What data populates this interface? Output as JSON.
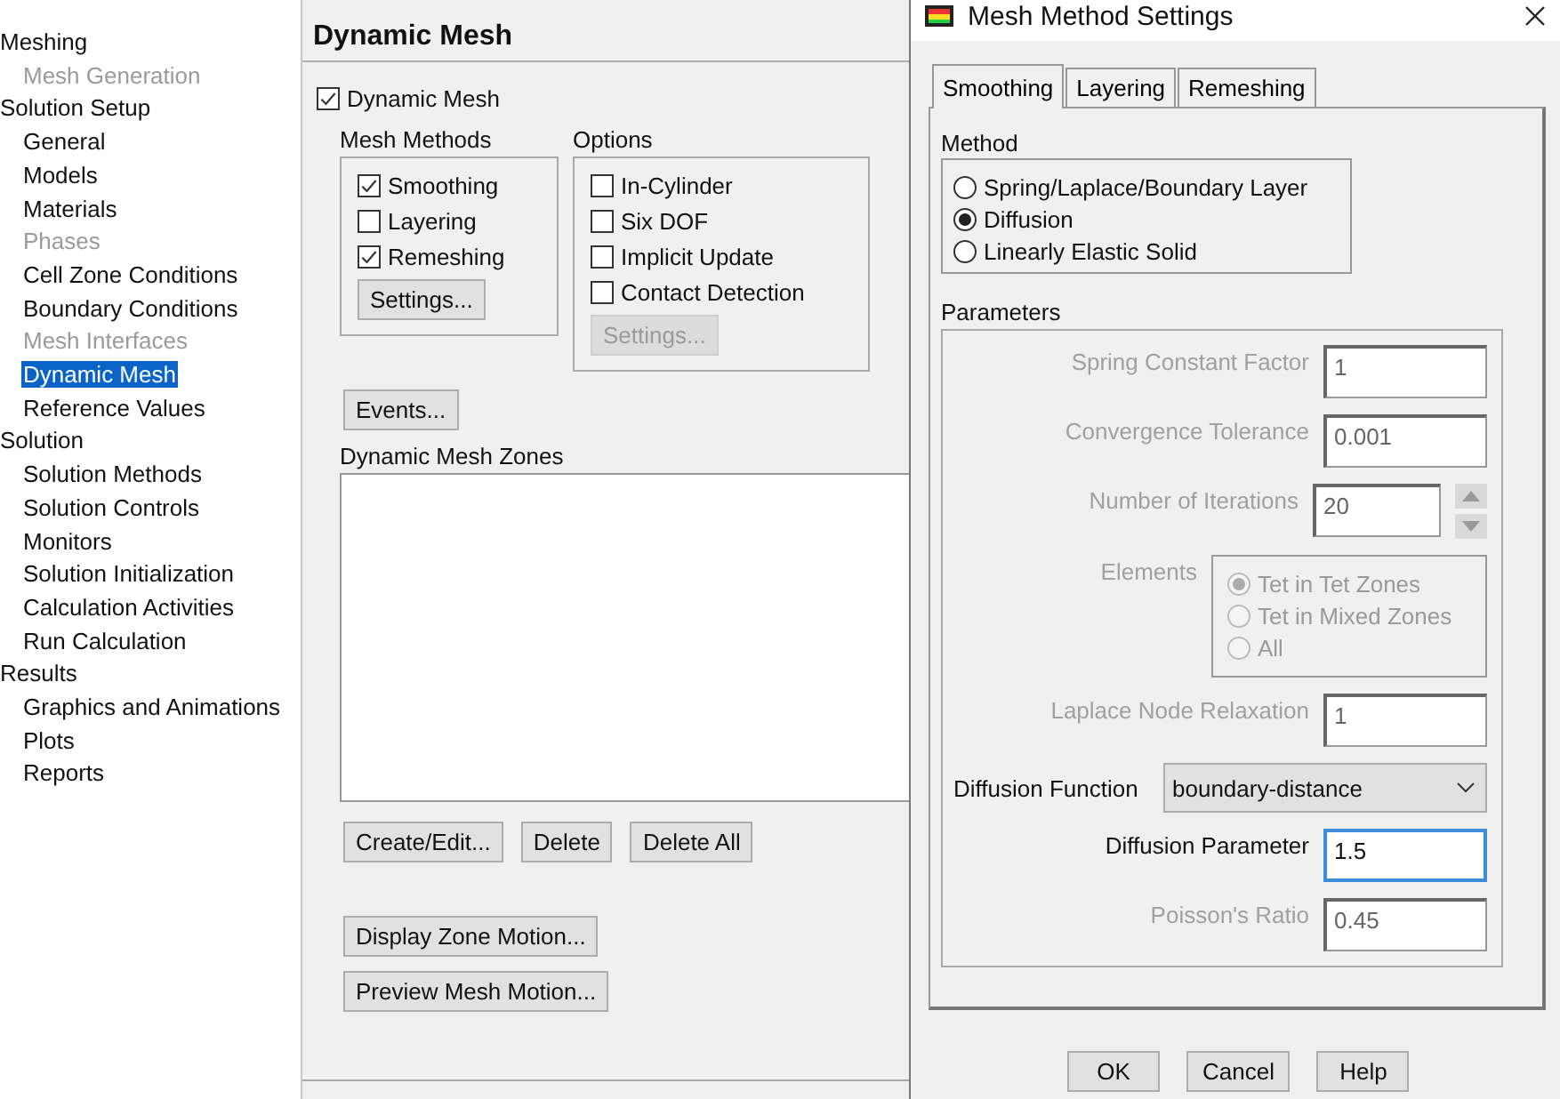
{
  "tree": [
    {
      "label": "Meshing",
      "children": [
        {
          "label": "Mesh Generation",
          "disabled": true,
          "selected": false
        }
      ]
    },
    {
      "label": "Solution Setup",
      "children": [
        {
          "label": "General",
          "disabled": false,
          "selected": false
        },
        {
          "label": "Models",
          "disabled": false,
          "selected": false
        },
        {
          "label": "Materials",
          "disabled": false,
          "selected": false
        },
        {
          "label": "Phases",
          "disabled": true,
          "selected": false
        },
        {
          "label": "Cell Zone Conditions",
          "disabled": false,
          "selected": false
        },
        {
          "label": "Boundary Conditions",
          "disabled": false,
          "selected": false
        },
        {
          "label": "Mesh Interfaces",
          "disabled": true,
          "selected": false
        },
        {
          "label": "Dynamic Mesh",
          "disabled": false,
          "selected": true
        },
        {
          "label": "Reference Values",
          "disabled": false,
          "selected": false
        }
      ]
    },
    {
      "label": "Solution",
      "children": [
        {
          "label": "Solution Methods",
          "disabled": false,
          "selected": false
        },
        {
          "label": "Solution Controls",
          "disabled": false,
          "selected": false
        },
        {
          "label": "Monitors",
          "disabled": false,
          "selected": false
        },
        {
          "label": "Solution Initialization",
          "disabled": false,
          "selected": false
        },
        {
          "label": "Calculation Activities",
          "disabled": false,
          "selected": false
        },
        {
          "label": "Run Calculation",
          "disabled": false,
          "selected": false
        }
      ]
    },
    {
      "label": "Results",
      "children": [
        {
          "label": "Graphics and Animations",
          "disabled": false,
          "selected": false
        },
        {
          "label": "Plots",
          "disabled": false,
          "selected": false
        },
        {
          "label": "Reports",
          "disabled": false,
          "selected": false
        }
      ]
    }
  ],
  "panel": {
    "title": "Dynamic Mesh",
    "dynamic_mesh": {
      "label": "Dynamic Mesh",
      "checked": true
    },
    "mesh_methods": {
      "title": "Mesh Methods",
      "items": [
        {
          "label": "Smoothing",
          "checked": true
        },
        {
          "label": "Layering",
          "checked": false
        },
        {
          "label": "Remeshing",
          "checked": true
        }
      ],
      "settings_button": {
        "label": "Settings...",
        "disabled": false
      }
    },
    "options": {
      "title": "Options",
      "items": [
        {
          "label": "In-Cylinder",
          "checked": false
        },
        {
          "label": "Six DOF",
          "checked": false
        },
        {
          "label": "Implicit Update",
          "checked": false
        },
        {
          "label": "Contact Detection",
          "checked": false
        }
      ],
      "settings_button": {
        "label": "Settings...",
        "disabled": true
      }
    },
    "events_button": "Events...",
    "zones": {
      "title": "Dynamic Mesh Zones"
    },
    "zone_buttons": [
      "Create/Edit...",
      "Delete",
      "Delete All"
    ],
    "motion_buttons": [
      "Display Zone Motion...",
      "Preview Mesh Motion..."
    ]
  },
  "dialog": {
    "title": "Mesh Method Settings",
    "tabs": [
      {
        "label": "Smoothing",
        "selected": true
      },
      {
        "label": "Layering",
        "selected": false
      },
      {
        "label": "Remeshing",
        "selected": false
      }
    ],
    "method": {
      "title": "Method",
      "options": [
        {
          "label": "Spring/Laplace/Boundary Layer",
          "selected": false
        },
        {
          "label": "Diffusion",
          "selected": true
        },
        {
          "label": "Linearly Elastic Solid",
          "selected": false
        }
      ]
    },
    "parameters": {
      "title": "Parameters",
      "rows": [
        {
          "kind": "field",
          "label": "Spring Constant Factor",
          "value": "1",
          "disabled": true,
          "focused": false
        },
        {
          "kind": "field",
          "label": "Convergence Tolerance",
          "value": "0.001",
          "disabled": true,
          "focused": false
        },
        {
          "kind": "spinner",
          "label": "Number of Iterations",
          "value": "20",
          "disabled": true
        },
        {
          "kind": "radios",
          "label": "Elements",
          "disabled": true,
          "options": [
            {
              "label": "Tet in Tet Zones",
              "selected": true
            },
            {
              "label": "Tet in Mixed Zones",
              "selected": false
            },
            {
              "label": "All",
              "selected": false
            }
          ]
        },
        {
          "kind": "field",
          "label": "Laplace Node Relaxation",
          "value": "1",
          "disabled": true,
          "focused": false
        },
        {
          "kind": "dropdown",
          "label": "Diffusion Function",
          "value": "boundary-distance",
          "disabled": false
        },
        {
          "kind": "field",
          "label": "Diffusion Parameter",
          "value": "1.5",
          "disabled": false,
          "focused": true
        },
        {
          "kind": "field",
          "label": "Poisson's Ratio",
          "value": "0.45",
          "disabled": true,
          "focused": false
        }
      ]
    },
    "buttons": [
      "OK",
      "Cancel",
      "Help"
    ]
  }
}
